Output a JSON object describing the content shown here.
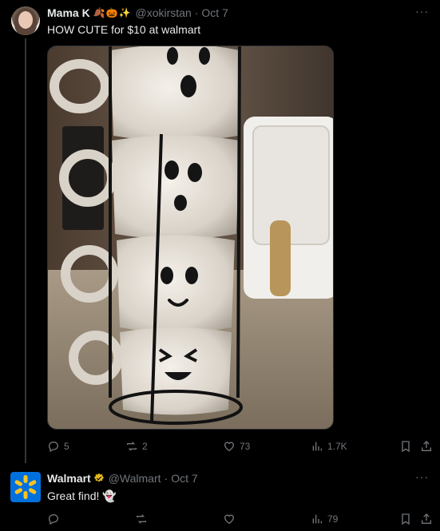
{
  "tweets": [
    {
      "name": "Mama K",
      "name_emojis": "🍂🎃✨",
      "handle": "@xokirstan",
      "separator": "·",
      "date": "Oct 7",
      "text": "HOW CUTE for $10 at walmart",
      "more_label": "···",
      "actions": {
        "replies": "5",
        "reposts": "2",
        "likes": "73",
        "views": "1.7K"
      }
    },
    {
      "name": "Walmart",
      "handle": "@Walmart",
      "separator": "·",
      "date": "Oct 7",
      "text": "Great find! 👻",
      "more_label": "···",
      "actions": {
        "replies": "",
        "reposts": "",
        "likes": "",
        "views": "79"
      }
    }
  ],
  "colors": {
    "background": "#000000",
    "text_primary": "#e7e9ea",
    "text_secondary": "#71767b",
    "walmart_blue": "#0071dc",
    "walmart_yellow": "#ffc220",
    "verified_gold": "#e2b719"
  },
  "icons": [
    "reply-icon",
    "repost-icon",
    "like-icon",
    "views-icon",
    "bookmark-icon",
    "share-icon",
    "verified-badge-icon",
    "more-icon"
  ]
}
